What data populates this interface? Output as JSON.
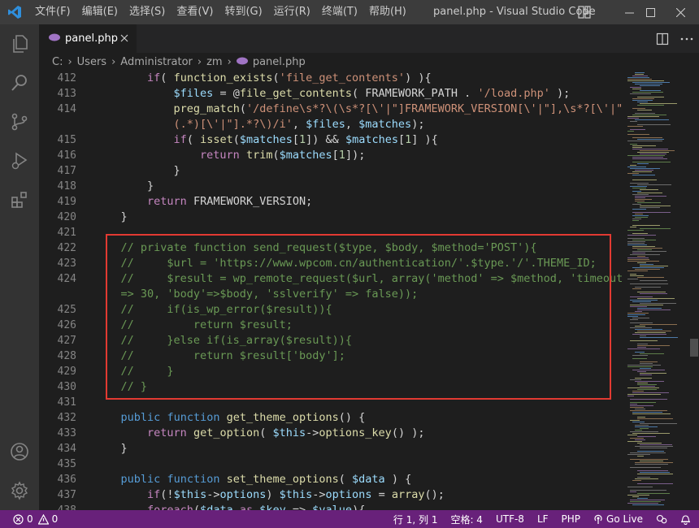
{
  "titlebar": {
    "menu": [
      "文件(F)",
      "编辑(E)",
      "选择(S)",
      "查看(V)",
      "转到(G)",
      "运行(R)",
      "终端(T)",
      "帮助(H)"
    ],
    "window_title": "panel.php - Visual Studio Code"
  },
  "tab": {
    "label": "panel.php"
  },
  "breadcrumb": {
    "items": [
      "C:",
      "Users",
      "Administrator",
      "zm",
      "panel.php"
    ]
  },
  "editor": {
    "line_numbers": [
      "412",
      "413",
      "414",
      "",
      "415",
      "416",
      "417",
      "418",
      "419",
      "420",
      "421",
      "422",
      "423",
      "424",
      "",
      "425",
      "426",
      "427",
      "428",
      "429",
      "430",
      "431",
      "432",
      "433",
      "434",
      "435",
      "436",
      "437",
      "438"
    ]
  },
  "statusbar": {
    "errors": "0",
    "warnings": "0",
    "position": "行 1, 列 1",
    "spaces": "空格: 4",
    "encoding": "UTF-8",
    "eol": "LF",
    "language": "PHP",
    "go_live": "Go Live"
  },
  "colors": {
    "statusbar": "#68217a",
    "highlight_border": "#e23a32",
    "editor_bg": "#1e1e1e"
  }
}
